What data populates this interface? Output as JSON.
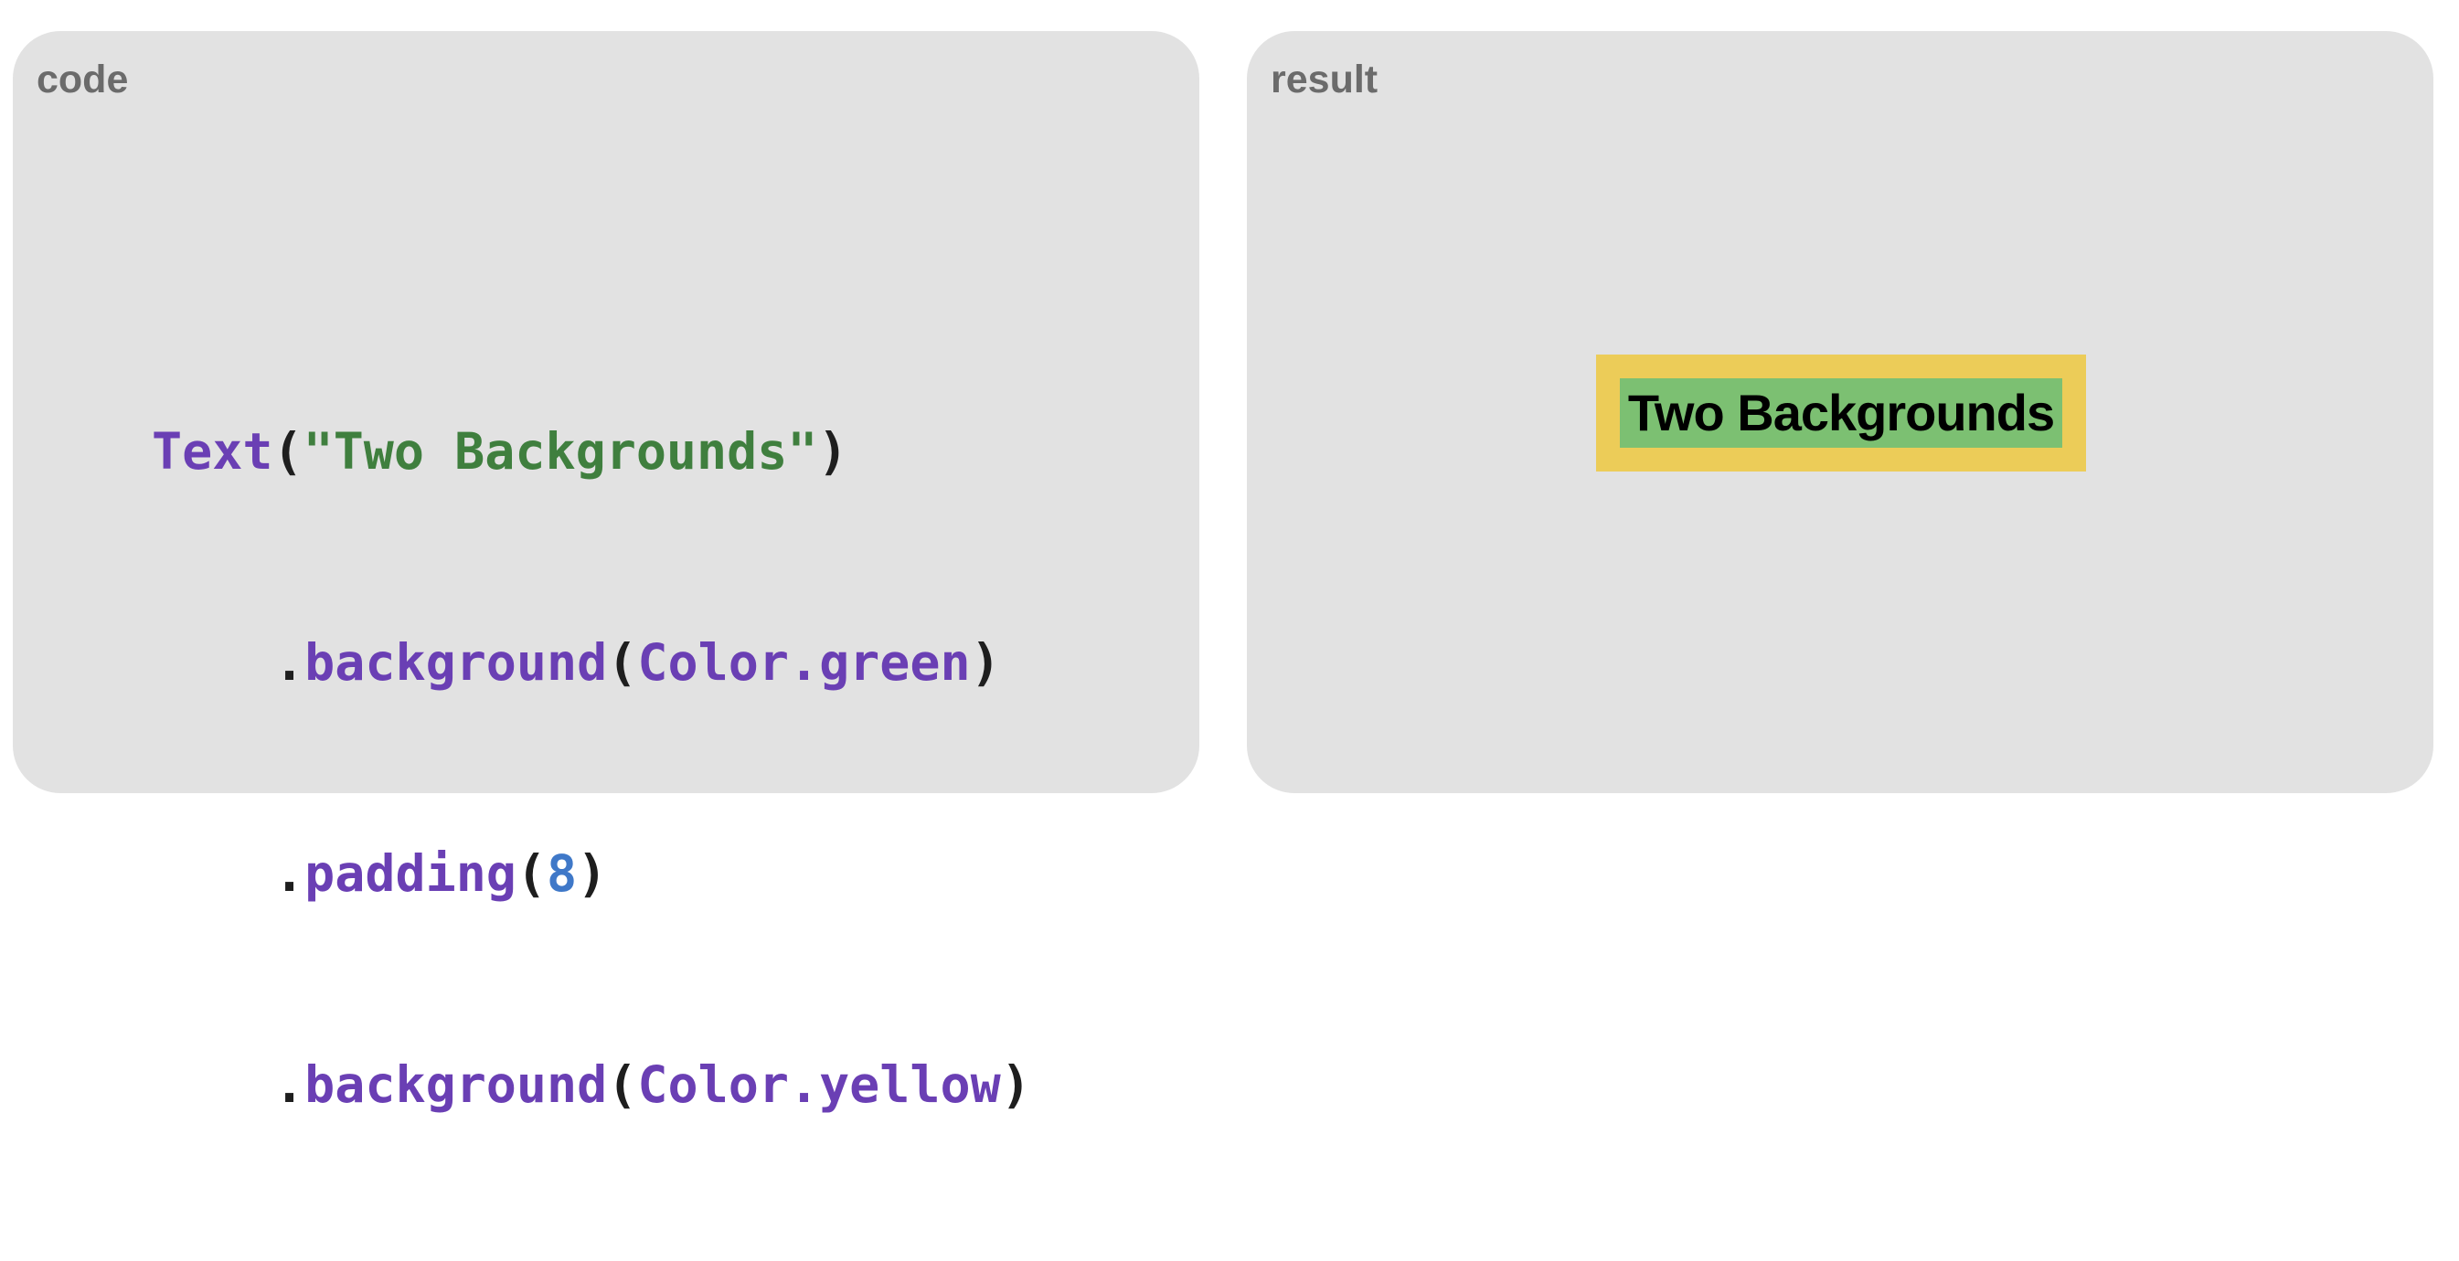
{
  "code_panel": {
    "label": "code",
    "lines": [
      {
        "parts": [
          {
            "text": "Text",
            "kind": "type"
          },
          {
            "text": "(",
            "kind": "punct"
          },
          {
            "text": "\"Two Backgrounds\"",
            "kind": "string"
          },
          {
            "text": ")",
            "kind": "punct"
          }
        ]
      },
      {
        "parts": [
          {
            "text": ".",
            "kind": "punct"
          },
          {
            "text": "background",
            "kind": "type"
          },
          {
            "text": "(",
            "kind": "punct"
          },
          {
            "text": "Color.green",
            "kind": "type"
          },
          {
            "text": ")",
            "kind": "punct"
          }
        ]
      },
      {
        "parts": [
          {
            "text": ".",
            "kind": "punct"
          },
          {
            "text": "padding",
            "kind": "type"
          },
          {
            "text": "(",
            "kind": "punct"
          },
          {
            "text": "8",
            "kind": "number"
          },
          {
            "text": ")",
            "kind": "punct"
          }
        ]
      },
      {
        "parts": [
          {
            "text": ".",
            "kind": "punct"
          },
          {
            "text": "background",
            "kind": "type"
          },
          {
            "text": "(",
            "kind": "punct"
          },
          {
            "text": "Color.yellow",
            "kind": "type"
          },
          {
            "text": ")",
            "kind": "punct"
          }
        ]
      }
    ]
  },
  "result_panel": {
    "label": "result",
    "preview_text": "Two Backgrounds",
    "inner_background": "#7cc072",
    "outer_background": "#eccc58"
  },
  "colors": {
    "panel_bg": "#e2e2e2",
    "label": "#6b6b6b",
    "type_token": "#6a3fb4",
    "string_token": "#3f7f3e",
    "number_token": "#3f78c8",
    "punct_token": "#1e1e1e"
  }
}
